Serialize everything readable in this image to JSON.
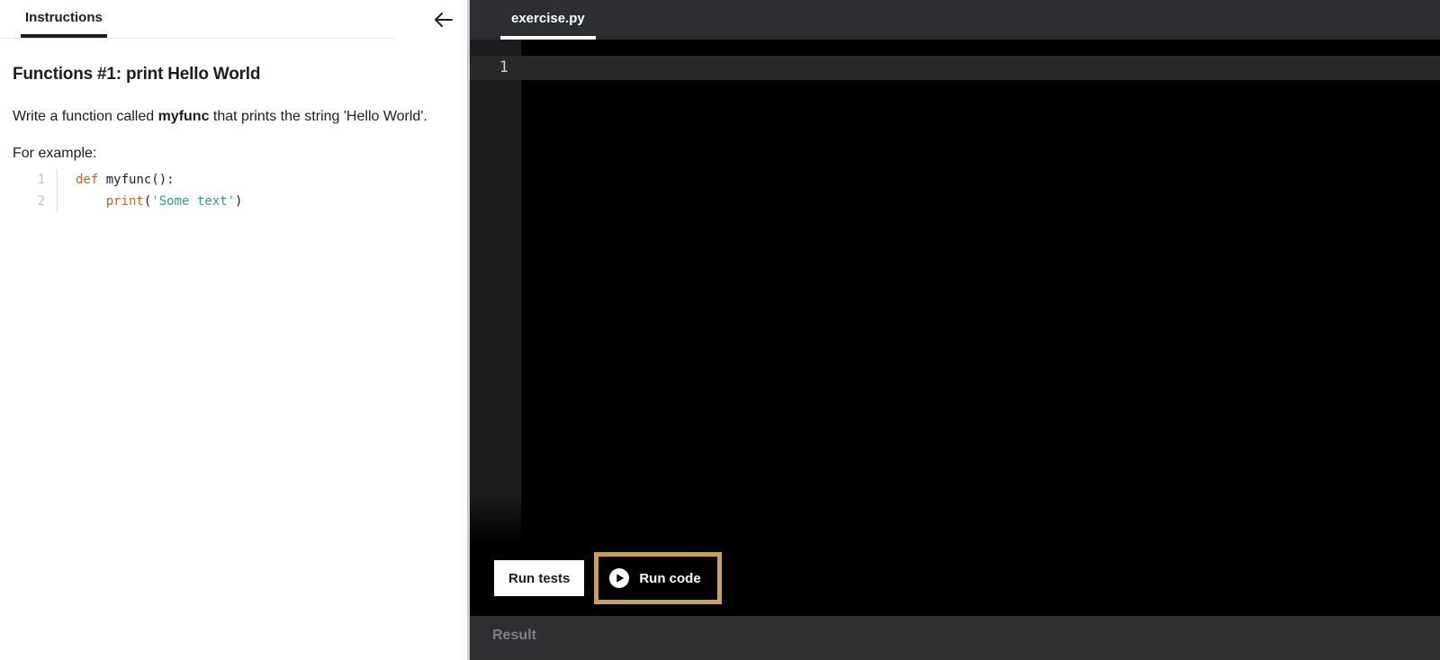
{
  "instructions_panel": {
    "tab_label": "Instructions",
    "heading": "Functions #1: print Hello World",
    "body": {
      "text_before_bold": "Write a function called ",
      "bold_term": "myfunc",
      "text_after_bold": " that prints the string 'Hello World'."
    },
    "example_label": "For example:",
    "example_code": {
      "line1": {
        "number": "1",
        "keyword": "def",
        "rest": " myfunc():"
      },
      "line2": {
        "number": "2",
        "indent": "    ",
        "keyword": "print",
        "paren_open": "(",
        "string": "'Some text'",
        "paren_close": ")"
      }
    }
  },
  "editor_panel": {
    "tab_label": "exercise.py",
    "gutter_line_number": "1",
    "buttons": {
      "run_tests": "Run tests",
      "run_code": "Run code"
    }
  },
  "result_panel": {
    "label": "Result"
  },
  "icons": {
    "collapse": "left-arrow-icon",
    "run_code": "play-icon"
  },
  "colors": {
    "focus_ring_gold": "#c9a24e",
    "keyword_orange": "#c4651a",
    "string_teal": "#2aa389",
    "dark_bar": "#2c2e31",
    "editor_background": "#000000",
    "active_line": "#27282a",
    "panel_divider": "#c9ced3",
    "muted_result_text": "#7d8185"
  }
}
